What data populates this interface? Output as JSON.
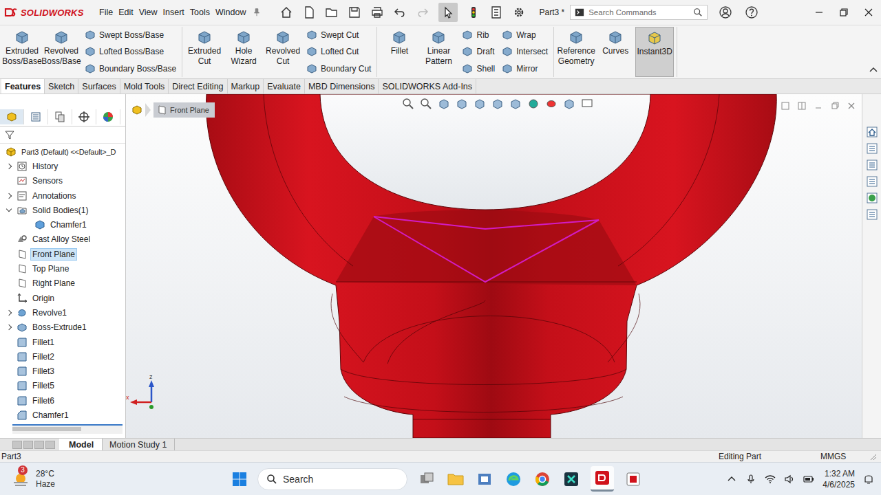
{
  "titlebar": {
    "logo": "SOLIDWORKS",
    "menus": [
      "File",
      "Edit",
      "View",
      "Insert",
      "Tools",
      "Window"
    ],
    "document": "Part3 *",
    "search_placeholder": "Search Commands"
  },
  "ribbon": [
    {
      "items": [
        {
          "kind": "large",
          "label": "Extruded Boss/Base",
          "selected": false
        },
        {
          "kind": "large",
          "label": "Revolved Boss/Base",
          "selected": false
        },
        {
          "kind": "stack",
          "items": [
            "Swept Boss/Base",
            "Lofted Boss/Base",
            "Boundary Boss/Base"
          ]
        }
      ]
    },
    {
      "items": [
        {
          "kind": "large",
          "label": "Extruded Cut",
          "selected": false
        },
        {
          "kind": "large",
          "label": "Hole Wizard",
          "selected": false
        },
        {
          "kind": "large",
          "label": "Revolved Cut",
          "selected": false
        },
        {
          "kind": "stack",
          "items": [
            "Swept Cut",
            "Lofted Cut",
            "Boundary Cut"
          ]
        }
      ]
    },
    {
      "items": [
        {
          "kind": "large",
          "label": "Fillet",
          "selected": false
        },
        {
          "kind": "large",
          "label": "Linear Pattern",
          "selected": false
        },
        {
          "kind": "stack",
          "items": [
            "Rib",
            "Draft",
            "Shell"
          ]
        },
        {
          "kind": "stack",
          "items": [
            "Wrap",
            "Intersect",
            "Mirror"
          ]
        }
      ]
    },
    {
      "items": [
        {
          "kind": "large",
          "label": "Reference Geometry",
          "selected": false
        },
        {
          "kind": "large",
          "label": "Curves",
          "selected": false
        },
        {
          "kind": "large",
          "label": "Instant3D",
          "selected": true
        }
      ]
    }
  ],
  "command_tabs": [
    {
      "label": "Features",
      "selected": true
    },
    {
      "label": "Sketch",
      "selected": false
    },
    {
      "label": "Surfaces",
      "selected": false
    },
    {
      "label": "Mold Tools",
      "selected": false
    },
    {
      "label": "Direct Editing",
      "selected": false
    },
    {
      "label": "Markup",
      "selected": false
    },
    {
      "label": "Evaluate",
      "selected": false
    },
    {
      "label": "MBD Dimensions",
      "selected": false
    },
    {
      "label": "SOLIDWORKS Add-Ins",
      "selected": false
    }
  ],
  "feature_tree": [
    {
      "label": "Part3 (Default) <<Default>_D",
      "kind": "part",
      "level": 0,
      "expandable": false,
      "expanded": false,
      "selected": false
    },
    {
      "label": "History",
      "kind": "history",
      "level": 0,
      "expandable": true,
      "expanded": false,
      "selected": false
    },
    {
      "label": "Sensors",
      "kind": "sensor",
      "level": 0,
      "expandable": false,
      "expanded": false,
      "selected": false
    },
    {
      "label": "Annotations",
      "kind": "annotation",
      "level": 0,
      "expandable": true,
      "expanded": false,
      "selected": false
    },
    {
      "label": "Solid Bodies(1)",
      "kind": "folder",
      "level": 0,
      "expandable": true,
      "expanded": true,
      "selected": false
    },
    {
      "label": "Chamfer1",
      "kind": "body",
      "level": 1,
      "expandable": false,
      "expanded": false,
      "selected": false
    },
    {
      "label": "Cast Alloy Steel",
      "kind": "material",
      "level": 0,
      "expandable": false,
      "expanded": false,
      "selected": false
    },
    {
      "label": "Front Plane",
      "kind": "plane",
      "level": 0,
      "expandable": false,
      "expanded": false,
      "selected": true
    },
    {
      "label": "Top Plane",
      "kind": "plane",
      "level": 0,
      "expandable": false,
      "expanded": false,
      "selected": false
    },
    {
      "label": "Right Plane",
      "kind": "plane",
      "level": 0,
      "expandable": false,
      "expanded": false,
      "selected": false
    },
    {
      "label": "Origin",
      "kind": "origin",
      "level": 0,
      "expandable": false,
      "expanded": false,
      "selected": false
    },
    {
      "label": "Revolve1",
      "kind": "revolve",
      "level": 0,
      "expandable": true,
      "expanded": false,
      "selected": false
    },
    {
      "label": "Boss-Extrude1",
      "kind": "extrude",
      "level": 0,
      "expandable": true,
      "expanded": false,
      "selected": false
    },
    {
      "label": "Fillet1",
      "kind": "fillet",
      "level": 0,
      "expandable": false,
      "expanded": false,
      "selected": false
    },
    {
      "label": "Fillet2",
      "kind": "fillet",
      "level": 0,
      "expandable": false,
      "expanded": false,
      "selected": false
    },
    {
      "label": "Fillet3",
      "kind": "fillet",
      "level": 0,
      "expandable": false,
      "expanded": false,
      "selected": false
    },
    {
      "label": "Fillet5",
      "kind": "fillet",
      "level": 0,
      "expandable": false,
      "expanded": false,
      "selected": false
    },
    {
      "label": "Fillet6",
      "kind": "fillet",
      "level": 0,
      "expandable": false,
      "expanded": false,
      "selected": false
    },
    {
      "label": "Chamfer1",
      "kind": "chamfer",
      "level": 0,
      "expandable": false,
      "expanded": false,
      "selected": false
    }
  ],
  "viewport": {
    "breadcrumb": "Front Plane",
    "axis_labels": [
      "z",
      "x"
    ]
  },
  "bottom_tabs": [
    {
      "label": "Model",
      "selected": true
    },
    {
      "label": "Motion Study 1",
      "selected": false
    }
  ],
  "status_bar": {
    "document": "Part3",
    "mode": "Editing Part",
    "units": "MMGS"
  },
  "taskbar": {
    "weather": {
      "badge": "3",
      "temperature": "28°C",
      "condition": "Haze"
    },
    "search_placeholder": "Search",
    "time": "1:32 AM",
    "date": "4/6/2025"
  }
}
